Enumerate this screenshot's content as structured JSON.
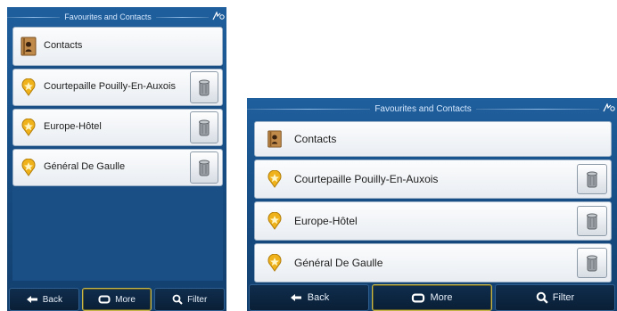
{
  "screens": [
    {
      "title": "Favourites and Contacts",
      "contacts_label": "Contacts",
      "favourites": [
        {
          "name": "Courtepaille Pouilly-En-Auxois"
        },
        {
          "name": "Europe-Hôtel"
        },
        {
          "name": "Général De Gaulle"
        }
      ],
      "buttons": {
        "back": "Back",
        "more": "More",
        "filter": "Filter"
      }
    },
    {
      "title": "Favourites and Contacts",
      "contacts_label": "Contacts",
      "favourites": [
        {
          "name": "Courtepaille Pouilly-En-Auxois"
        },
        {
          "name": "Europe-Hôtel"
        },
        {
          "name": "Général De Gaulle"
        }
      ],
      "buttons": {
        "back": "Back",
        "more": "More",
        "filter": "Filter"
      }
    }
  ],
  "icons": {
    "status": "gps-status-icon",
    "contacts": "address-book-icon",
    "favourite": "star-pin-icon",
    "delete": "trash-icon",
    "back": "back-arrow-icon",
    "more": "more-icon",
    "filter": "magnifier-icon"
  },
  "colors": {
    "background": "#174f87",
    "title_text": "#d7e9ff",
    "row_bg": "#f0f3f7",
    "star": "#f0b21b",
    "more_border": "#c8b84c"
  }
}
